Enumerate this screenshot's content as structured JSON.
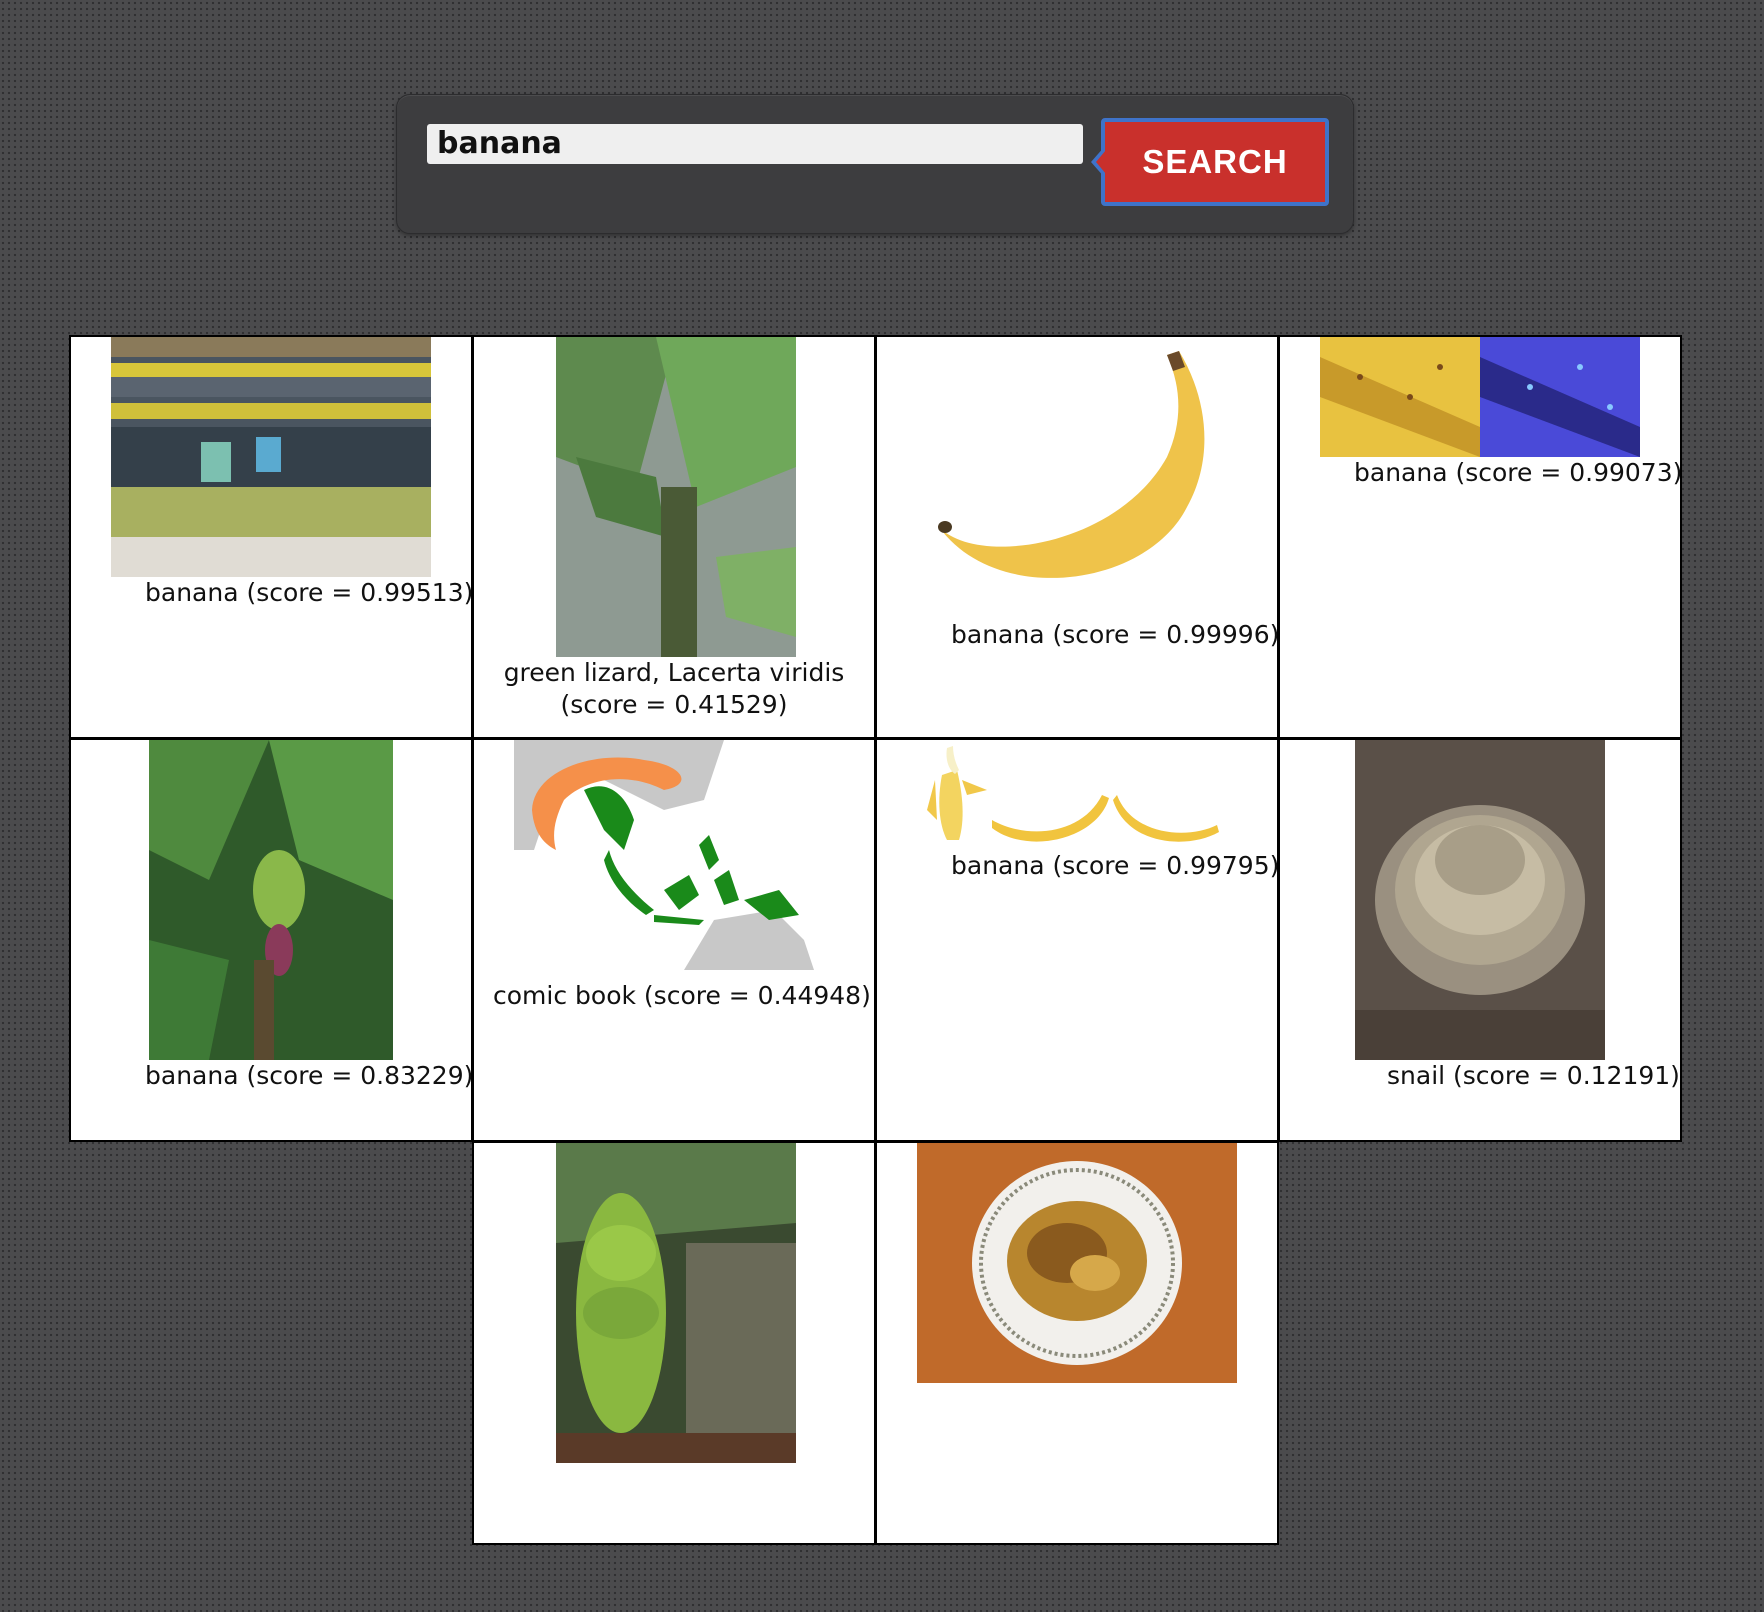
{
  "search": {
    "query": "banana",
    "button_label": "SEARCH"
  },
  "results": [
    {
      "caption": "banana (score = 0.99513)"
    },
    {
      "caption_line1": "green lizard, Lacerta viridis",
      "caption_line2": "(score = 0.41529)"
    },
    {
      "caption": "banana (score = 0.99996)"
    },
    {
      "caption": "banana (score = 0.99073)"
    },
    {
      "caption": "banana (score = 0.83229)"
    },
    {
      "caption": "comic book (score = 0.44948)"
    },
    {
      "caption": "banana (score = 0.99795)"
    },
    {
      "caption": "snail (score = 0.12191)"
    },
    {},
    {}
  ]
}
